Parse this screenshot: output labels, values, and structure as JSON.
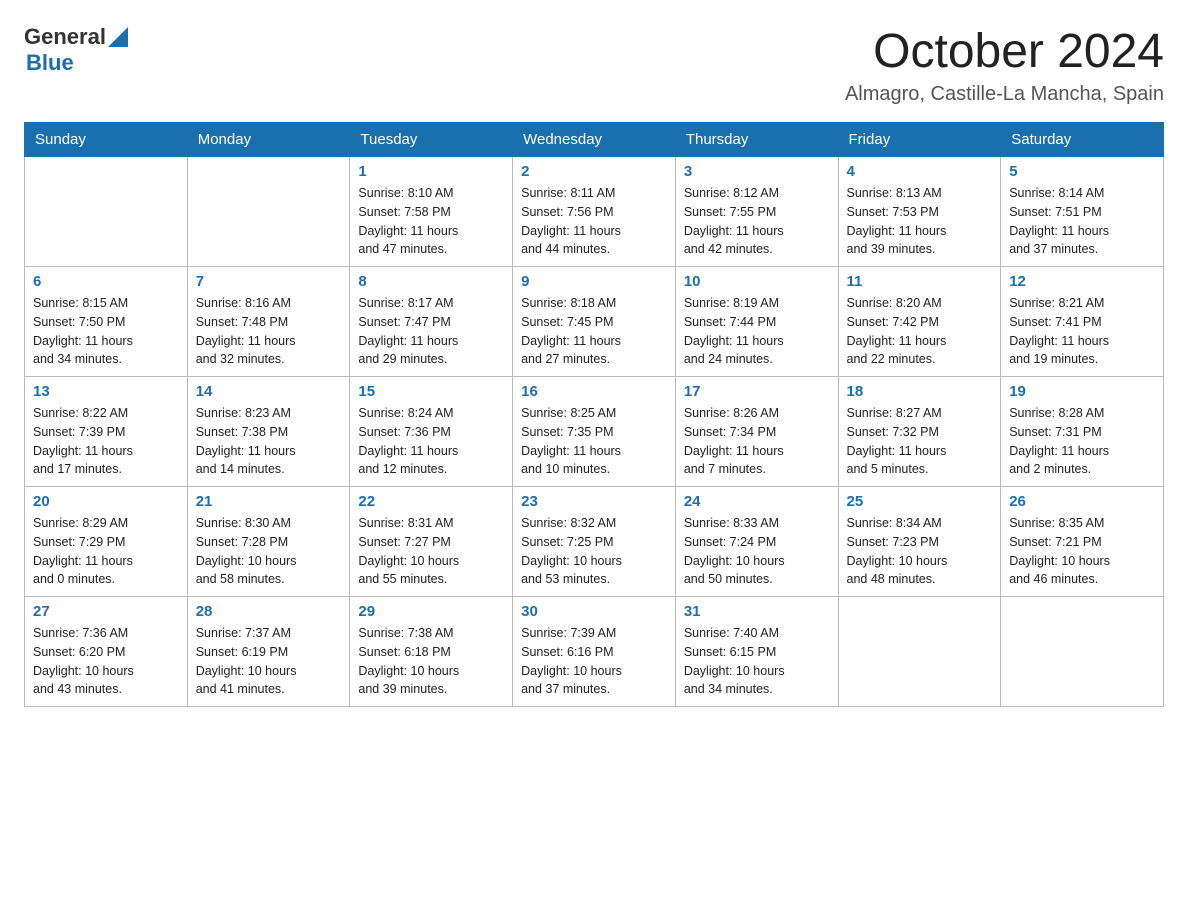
{
  "logo": {
    "general": "General",
    "arrow": "▲",
    "blue": "Blue"
  },
  "header": {
    "month": "October 2024",
    "location": "Almagro, Castille-La Mancha, Spain"
  },
  "weekdays": [
    "Sunday",
    "Monday",
    "Tuesday",
    "Wednesday",
    "Thursday",
    "Friday",
    "Saturday"
  ],
  "weeks": [
    [
      {
        "day": "",
        "info": ""
      },
      {
        "day": "",
        "info": ""
      },
      {
        "day": "1",
        "info": "Sunrise: 8:10 AM\nSunset: 7:58 PM\nDaylight: 11 hours\nand 47 minutes."
      },
      {
        "day": "2",
        "info": "Sunrise: 8:11 AM\nSunset: 7:56 PM\nDaylight: 11 hours\nand 44 minutes."
      },
      {
        "day": "3",
        "info": "Sunrise: 8:12 AM\nSunset: 7:55 PM\nDaylight: 11 hours\nand 42 minutes."
      },
      {
        "day": "4",
        "info": "Sunrise: 8:13 AM\nSunset: 7:53 PM\nDaylight: 11 hours\nand 39 minutes."
      },
      {
        "day": "5",
        "info": "Sunrise: 8:14 AM\nSunset: 7:51 PM\nDaylight: 11 hours\nand 37 minutes."
      }
    ],
    [
      {
        "day": "6",
        "info": "Sunrise: 8:15 AM\nSunset: 7:50 PM\nDaylight: 11 hours\nand 34 minutes."
      },
      {
        "day": "7",
        "info": "Sunrise: 8:16 AM\nSunset: 7:48 PM\nDaylight: 11 hours\nand 32 minutes."
      },
      {
        "day": "8",
        "info": "Sunrise: 8:17 AM\nSunset: 7:47 PM\nDaylight: 11 hours\nand 29 minutes."
      },
      {
        "day": "9",
        "info": "Sunrise: 8:18 AM\nSunset: 7:45 PM\nDaylight: 11 hours\nand 27 minutes."
      },
      {
        "day": "10",
        "info": "Sunrise: 8:19 AM\nSunset: 7:44 PM\nDaylight: 11 hours\nand 24 minutes."
      },
      {
        "day": "11",
        "info": "Sunrise: 8:20 AM\nSunset: 7:42 PM\nDaylight: 11 hours\nand 22 minutes."
      },
      {
        "day": "12",
        "info": "Sunrise: 8:21 AM\nSunset: 7:41 PM\nDaylight: 11 hours\nand 19 minutes."
      }
    ],
    [
      {
        "day": "13",
        "info": "Sunrise: 8:22 AM\nSunset: 7:39 PM\nDaylight: 11 hours\nand 17 minutes."
      },
      {
        "day": "14",
        "info": "Sunrise: 8:23 AM\nSunset: 7:38 PM\nDaylight: 11 hours\nand 14 minutes."
      },
      {
        "day": "15",
        "info": "Sunrise: 8:24 AM\nSunset: 7:36 PM\nDaylight: 11 hours\nand 12 minutes."
      },
      {
        "day": "16",
        "info": "Sunrise: 8:25 AM\nSunset: 7:35 PM\nDaylight: 11 hours\nand 10 minutes."
      },
      {
        "day": "17",
        "info": "Sunrise: 8:26 AM\nSunset: 7:34 PM\nDaylight: 11 hours\nand 7 minutes."
      },
      {
        "day": "18",
        "info": "Sunrise: 8:27 AM\nSunset: 7:32 PM\nDaylight: 11 hours\nand 5 minutes."
      },
      {
        "day": "19",
        "info": "Sunrise: 8:28 AM\nSunset: 7:31 PM\nDaylight: 11 hours\nand 2 minutes."
      }
    ],
    [
      {
        "day": "20",
        "info": "Sunrise: 8:29 AM\nSunset: 7:29 PM\nDaylight: 11 hours\nand 0 minutes."
      },
      {
        "day": "21",
        "info": "Sunrise: 8:30 AM\nSunset: 7:28 PM\nDaylight: 10 hours\nand 58 minutes."
      },
      {
        "day": "22",
        "info": "Sunrise: 8:31 AM\nSunset: 7:27 PM\nDaylight: 10 hours\nand 55 minutes."
      },
      {
        "day": "23",
        "info": "Sunrise: 8:32 AM\nSunset: 7:25 PM\nDaylight: 10 hours\nand 53 minutes."
      },
      {
        "day": "24",
        "info": "Sunrise: 8:33 AM\nSunset: 7:24 PM\nDaylight: 10 hours\nand 50 minutes."
      },
      {
        "day": "25",
        "info": "Sunrise: 8:34 AM\nSunset: 7:23 PM\nDaylight: 10 hours\nand 48 minutes."
      },
      {
        "day": "26",
        "info": "Sunrise: 8:35 AM\nSunset: 7:21 PM\nDaylight: 10 hours\nand 46 minutes."
      }
    ],
    [
      {
        "day": "27",
        "info": "Sunrise: 7:36 AM\nSunset: 6:20 PM\nDaylight: 10 hours\nand 43 minutes."
      },
      {
        "day": "28",
        "info": "Sunrise: 7:37 AM\nSunset: 6:19 PM\nDaylight: 10 hours\nand 41 minutes."
      },
      {
        "day": "29",
        "info": "Sunrise: 7:38 AM\nSunset: 6:18 PM\nDaylight: 10 hours\nand 39 minutes."
      },
      {
        "day": "30",
        "info": "Sunrise: 7:39 AM\nSunset: 6:16 PM\nDaylight: 10 hours\nand 37 minutes."
      },
      {
        "day": "31",
        "info": "Sunrise: 7:40 AM\nSunset: 6:15 PM\nDaylight: 10 hours\nand 34 minutes."
      },
      {
        "day": "",
        "info": ""
      },
      {
        "day": "",
        "info": ""
      }
    ]
  ]
}
